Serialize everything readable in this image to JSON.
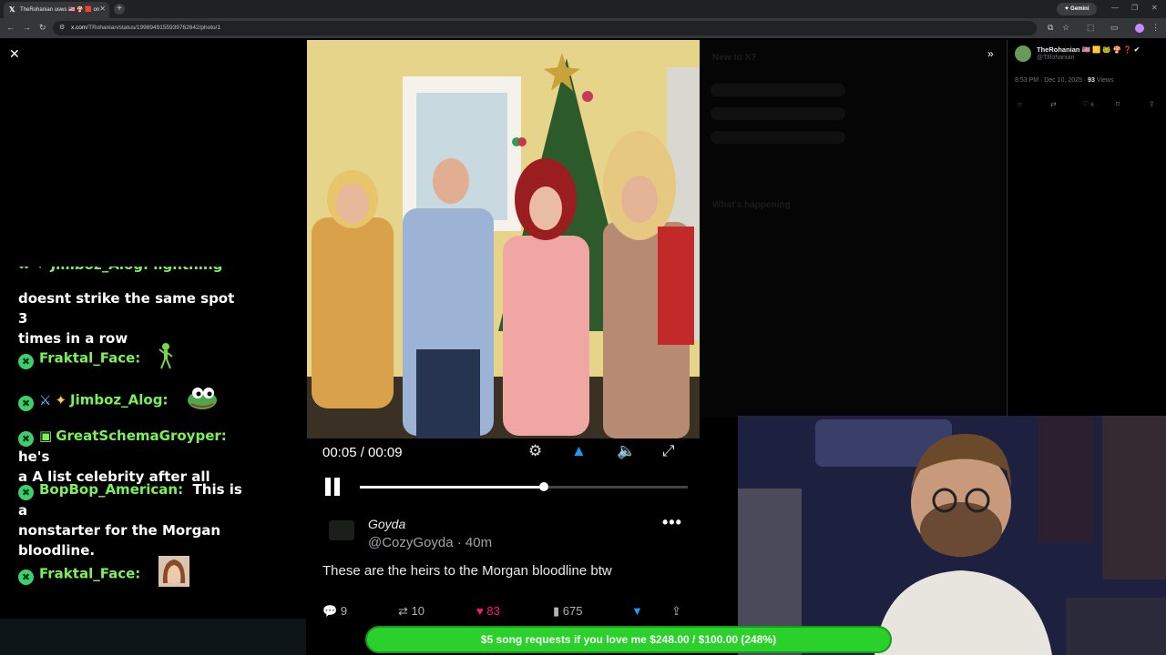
{
  "browser": {
    "tab_title": "TheRohanian usws 🇺🇸 🍄 🟥 on",
    "new_tab": "+",
    "gemini_label": "✦ Gemini",
    "url_host": "x.com",
    "url_path": "/TRohanian/status/1998949155939762642/photo/1"
  },
  "chat": {
    "messages": [
      {
        "lines": [
          "doesnt strike the same spot 3",
          "times in a row"
        ]
      },
      {
        "user": "Fraktal_Face:",
        "emote": "dancing-alien-emote"
      },
      {
        "user": "Jimboz_Alog:",
        "emote": "pepe-frog-emote"
      },
      {
        "user": "GreatSchemaGroyper:",
        "text": "he's",
        "line2": "a A list celebrity after all"
      },
      {
        "user": "BopBop_American:",
        "text": "This is a",
        "line2": "nonstarter for the Morgan",
        "line3": "bloodline."
      },
      {
        "user": "Fraktal_Face:",
        "emote": "face-emote"
      }
    ]
  },
  "video": {
    "time": "00:05 / 00:09",
    "progress_fraction": 0.56
  },
  "tweet": {
    "display_name": "Goyda",
    "handle_time": "@CozyGoyda · 40m",
    "text": "These are the heirs to the Morgan bloodline btw",
    "replies": "9",
    "reposts": "10",
    "likes": "83",
    "views": "675",
    "more": "•••"
  },
  "post": {
    "name": "TheRohanian 🇺🇸 🟨 🐸 🍄 ❓ ✔",
    "handle": "@TRohanian",
    "time": "8:53 PM · Dec 10, 2025 · ",
    "views_num": "93",
    "views_label": " Views",
    "likes": "6"
  },
  "sidebar_ghost": {
    "new_to_x": "New to X?",
    "whats_happening": "What's happening"
  },
  "overlay": {
    "donation": "$5 song requests if you love me $248.00 / $100.00 (248%)"
  }
}
